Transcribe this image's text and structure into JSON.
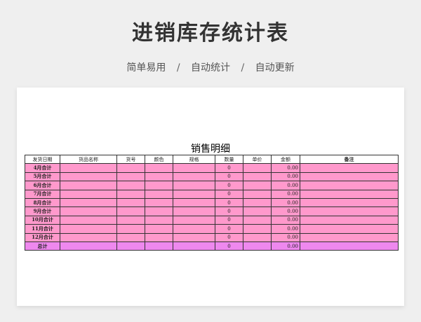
{
  "page": {
    "title": "进销库存统计表",
    "subtitle_items": [
      "简单易用",
      "自动统计",
      "自动更新"
    ],
    "separator": "/"
  },
  "sheet": {
    "title": "销售明细",
    "headers": [
      "发货日期",
      "货品名称",
      "货号",
      "颜色",
      "规格",
      "数量",
      "单价",
      "金额",
      "备注"
    ],
    "rows": [
      {
        "label": "4月合计",
        "qty": "0",
        "amount": "0.00"
      },
      {
        "label": "5月合计",
        "qty": "0",
        "amount": "0.00"
      },
      {
        "label": "6月合计",
        "qty": "0",
        "amount": "0.00"
      },
      {
        "label": "7月合计",
        "qty": "0",
        "amount": "0.00"
      },
      {
        "label": "8月合计",
        "qty": "0",
        "amount": "0.00"
      },
      {
        "label": "9月合计",
        "qty": "0",
        "amount": "0.00"
      },
      {
        "label": "10月合计",
        "qty": "0",
        "amount": "0.00"
      },
      {
        "label": "11月合计",
        "qty": "0",
        "amount": "0.00"
      },
      {
        "label": "12月合计",
        "qty": "0",
        "amount": "0.00"
      }
    ],
    "total": {
      "label": "总计",
      "qty": "0",
      "amount": "0.00"
    }
  },
  "colors": {
    "background": "#efefef",
    "month_row": "#ff99cc",
    "total_row": "#ee88ee"
  }
}
